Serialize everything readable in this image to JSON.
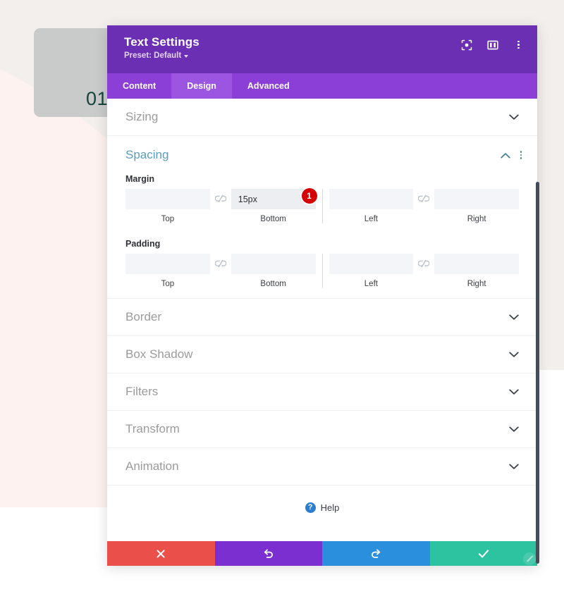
{
  "background": {
    "card_number": "01",
    "band_color": "#f2efec",
    "curve_color": "#fdf2f0",
    "card_color": "#c9cbcb",
    "number_color": "#15443a"
  },
  "modal": {
    "title": "Text Settings",
    "preset_label": "Preset: Default",
    "header_color": "#6b2fb3",
    "tabbar_color": "#8b3fd6",
    "active_tab_color": "#9b55e0",
    "header_icons": [
      {
        "name": "focus-target-icon",
        "title": "Focus"
      },
      {
        "name": "columns-layout-icon",
        "title": "Layout"
      },
      {
        "name": "vertical-dots-icon",
        "title": "More options"
      }
    ],
    "tabs": [
      {
        "label": "Content",
        "active": false
      },
      {
        "label": "Design",
        "active": true
      },
      {
        "label": "Advanced",
        "active": false
      }
    ],
    "sections_before": [
      {
        "label": "Sizing",
        "state": "collapsed"
      }
    ],
    "open_section": {
      "label": "Spacing",
      "accent_color": "#5a9cc1",
      "state": "expanded",
      "groups": [
        {
          "label": "Margin",
          "fields": [
            {
              "caption": "Top",
              "value": "",
              "placeholder": "",
              "filled": false,
              "badge": null
            },
            {
              "caption": "Bottom",
              "value": "15px",
              "placeholder": "",
              "filled": true,
              "badge": "1"
            },
            {
              "caption": "Left",
              "value": "",
              "placeholder": "",
              "filled": false,
              "badge": null
            },
            {
              "caption": "Right",
              "value": "",
              "placeholder": "",
              "filled": false,
              "badge": null
            }
          ]
        },
        {
          "label": "Padding",
          "fields": [
            {
              "caption": "Top",
              "value": "",
              "placeholder": "",
              "filled": false,
              "badge": null
            },
            {
              "caption": "Bottom",
              "value": "",
              "placeholder": "",
              "filled": false,
              "badge": null
            },
            {
              "caption": "Left",
              "value": "",
              "placeholder": "",
              "filled": false,
              "badge": null
            },
            {
              "caption": "Right",
              "value": "",
              "placeholder": "",
              "filled": false,
              "badge": null
            }
          ]
        }
      ]
    },
    "sections_after": [
      {
        "label": "Border",
        "state": "collapsed"
      },
      {
        "label": "Box Shadow",
        "state": "collapsed"
      },
      {
        "label": "Filters",
        "state": "collapsed"
      },
      {
        "label": "Transform",
        "state": "collapsed"
      },
      {
        "label": "Animation",
        "state": "collapsed"
      }
    ],
    "help": {
      "icon_char": "?",
      "label": "Help",
      "icon_color": "#2a7dd1"
    },
    "actions": [
      {
        "name": "close-button",
        "icon": "cross-icon",
        "color": "#eb4f4a"
      },
      {
        "name": "undo-button",
        "icon": "undo-icon",
        "color": "#7b2fd1"
      },
      {
        "name": "redo-button",
        "icon": "redo-icon",
        "color": "#2a8fdc"
      },
      {
        "name": "save-button",
        "icon": "checkmark-icon",
        "color": "#2ec3a0"
      }
    ]
  },
  "badge_color": "#d50000"
}
